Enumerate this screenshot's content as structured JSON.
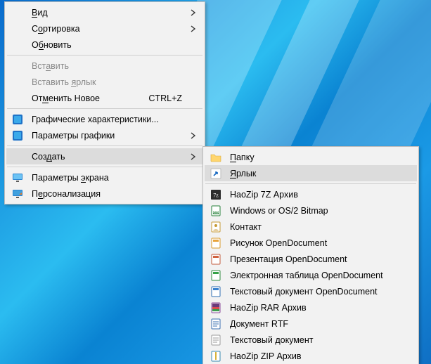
{
  "desktop": {
    "os": "Windows 10"
  },
  "main": {
    "items": [
      {
        "k": "view",
        "label": "_Вид",
        "arrow": true
      },
      {
        "k": "sort",
        "label": "С_ортировка",
        "arrow": true
      },
      {
        "k": "refresh",
        "label": "О_бновить"
      },
      {
        "k": "sep"
      },
      {
        "k": "paste",
        "label": "Вст_авить",
        "disabled": true
      },
      {
        "k": "paste_shortcut",
        "label": "Вставить _ярлык",
        "disabled": true
      },
      {
        "k": "undo",
        "label": "От_менить Новое",
        "accel": "CTRL+Z"
      },
      {
        "k": "sep"
      },
      {
        "k": "gfx_props",
        "label": "Графические характеристики...",
        "icon": "intel-icon"
      },
      {
        "k": "gfx_params",
        "label": "Параметры графики",
        "icon": "intel-icon",
        "arrow": true
      },
      {
        "k": "sep"
      },
      {
        "k": "create",
        "label": "Соз_дать",
        "arrow": true,
        "highlight": true
      },
      {
        "k": "sep"
      },
      {
        "k": "display",
        "label": "Параметры _экрана",
        "icon": "monitor-icon"
      },
      {
        "k": "personalize",
        "label": "П_ерсонализация",
        "icon": "personalization-icon"
      }
    ]
  },
  "sub": {
    "items": [
      {
        "k": "folder",
        "label": "_Папку",
        "icon": "folder-icon"
      },
      {
        "k": "shortcut",
        "label": "_Ярлык",
        "icon": "shortcut-icon",
        "highlight": true
      },
      {
        "k": "sep"
      },
      {
        "k": "7z",
        "label": "HaoZip 7Z Архив",
        "icon": "sevenz-icon"
      },
      {
        "k": "bmp",
        "label": "Windows or OS/2 Bitmap",
        "icon": "bmp-icon"
      },
      {
        "k": "contact",
        "label": "Контакт",
        "icon": "contact-icon"
      },
      {
        "k": "odg",
        "label": "Рисунок OpenDocument",
        "icon": "odg-icon"
      },
      {
        "k": "odp",
        "label": "Презентация OpenDocument",
        "icon": "odp-icon"
      },
      {
        "k": "ods",
        "label": "Электронная таблица OpenDocument",
        "icon": "ods-icon"
      },
      {
        "k": "odt",
        "label": "Текстовый документ OpenDocument",
        "icon": "odt-icon"
      },
      {
        "k": "rar",
        "label": "HaoZip RAR Архив",
        "icon": "rar-icon"
      },
      {
        "k": "rtf",
        "label": "Документ RTF",
        "icon": "rtf-icon"
      },
      {
        "k": "txt",
        "label": "Текстовый документ",
        "icon": "txt-icon"
      },
      {
        "k": "zip",
        "label": "HaoZip ZIP Архив",
        "icon": "zip-icon"
      }
    ]
  }
}
